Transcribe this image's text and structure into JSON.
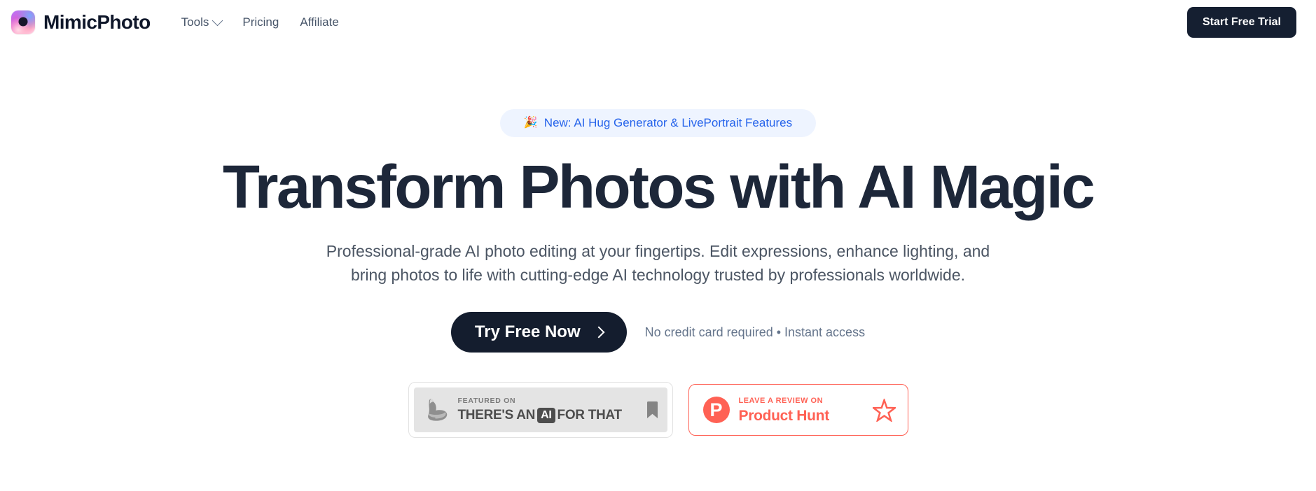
{
  "colors": {
    "brand_dark": "#151f31",
    "accent_blue": "#2563eb",
    "badge_blue_bg": "#eef4ff",
    "product_hunt": "#ff6154",
    "heading": "#1d2739",
    "body_text": "#4b5563",
    "nav_text": "#475569"
  },
  "header": {
    "logo_icon": "aperture-gradient-icon",
    "brand_name": "MimicPhoto",
    "nav": [
      {
        "label": "Tools",
        "has_dropdown": true,
        "dropdown_icon": "chevron-down-icon"
      },
      {
        "label": "Pricing",
        "has_dropdown": false
      },
      {
        "label": "Affiliate",
        "has_dropdown": false
      }
    ],
    "trial_button": "Start Free Trial"
  },
  "hero": {
    "announcement": {
      "emoji": "🎉",
      "emoji_name": "party-popper-icon",
      "text": "New: AI Hug Generator & LivePortrait Features"
    },
    "headline": "Transform Photos with AI Magic",
    "subheadline": "Professional-grade AI photo editing at your fingertips. Edit expressions, enhance lighting, and bring photos to life with cutting-edge AI technology trusted by professionals worldwide.",
    "cta_button": "Try Free Now",
    "cta_icon": "chevron-right-icon",
    "cta_note": "No credit card required • Instant access"
  },
  "badges": {
    "theres_an_ai_for_that": {
      "arm_icon": "flexed-bicep-icon",
      "small_text": "FEATURED ON",
      "big_text_before": "THERE'S AN",
      "chip_text": "AI",
      "big_text_after": "FOR THAT",
      "bookmark_icon": "bookmark-icon"
    },
    "product_hunt": {
      "mark": "P",
      "mark_icon": "product-hunt-logo-icon",
      "small_text": "LEAVE A REVIEW ON",
      "big_text": "Product Hunt",
      "star_icon": "star-outline-icon"
    }
  }
}
